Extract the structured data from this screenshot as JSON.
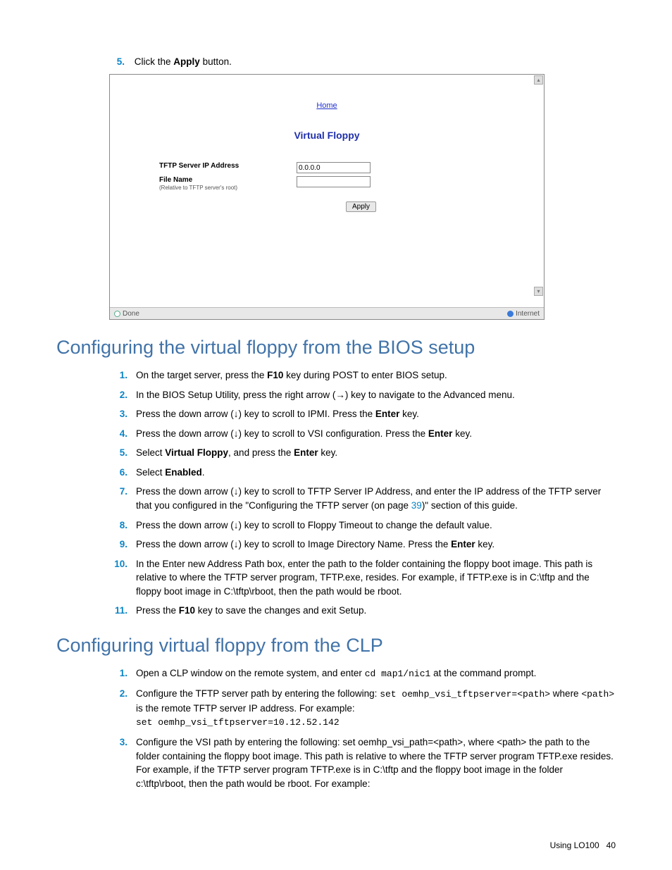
{
  "intro": {
    "num": "5.",
    "pre": "Click the ",
    "bold": "Apply",
    "post": " button."
  },
  "shot": {
    "home": "Home",
    "title": "Virtual Floppy",
    "row1_label": "TFTP Server IP Address",
    "row1_value": "0.0.0.0",
    "row2_label": "File Name",
    "row2_sub": "(Relative to TFTP server's root)",
    "apply": "Apply",
    "status_done": "Done",
    "status_net": "Internet"
  },
  "sec1": {
    "title": "Configuring the virtual floppy from the BIOS setup",
    "items": [
      {
        "n": "1.",
        "txt_pre": "On the target server, press the ",
        "b1": "F10",
        "txt_post": " key during POST to enter BIOS setup."
      },
      {
        "n": "2.",
        "txt": "In the BIOS Setup Utility, press the right arrow (→) key to navigate to the Advanced menu."
      },
      {
        "n": "3.",
        "txt_pre": "Press the down arrow (↓) key to scroll to IPMI. Press the ",
        "b1": "Enter",
        "txt_post": " key."
      },
      {
        "n": "4.",
        "txt_pre": "Press the down arrow (↓) key to scroll to VSI configuration. Press the ",
        "b1": "Enter",
        "txt_post": " key."
      },
      {
        "n": "5.",
        "txt_pre": "Select ",
        "b1": "Virtual Floppy",
        "txt_mid": ", and press the ",
        "b2": "Enter",
        "txt_post": " key."
      },
      {
        "n": "6.",
        "txt_pre": "Select ",
        "b1": "Enabled",
        "txt_post": "."
      },
      {
        "n": "7.",
        "txt_pre": "Press the down arrow (↓) key to scroll to TFTP Server IP Address, and enter the IP address of the TFTP server that you configured in the \"Configuring the TFTP server (on page ",
        "link": "39",
        "txt_post": ")\" section of this guide."
      },
      {
        "n": "8.",
        "txt": "Press the down arrow (↓) key to scroll to Floppy Timeout to change the default value."
      },
      {
        "n": "9.",
        "txt_pre": "Press the down arrow (↓) key to scroll to Image Directory Name. Press the ",
        "b1": "Enter",
        "txt_post": " key."
      },
      {
        "n": "10.",
        "txt": "In the Enter new Address Path box, enter the path to the folder containing the floppy boot image. This path is relative to where the TFTP server program, TFTP.exe, resides. For example, if TFTP.exe is in C:\\tftp and the floppy boot image in C:\\tftp\\rboot, then the path would be rboot."
      },
      {
        "n": "11.",
        "txt_pre": "Press the ",
        "b1": "F10",
        "txt_post": " key to save the changes and exit Setup."
      }
    ]
  },
  "sec2": {
    "title": "Configuring virtual floppy from the CLP",
    "items": [
      {
        "n": "1.",
        "parts": [
          {
            "t": "Open a CLP window on the remote system, and enter "
          },
          {
            "m": "cd map1/nic1"
          },
          {
            "t": " at the command prompt."
          }
        ]
      },
      {
        "n": "2.",
        "parts": [
          {
            "t": "Configure the TFTP server path by entering the following: "
          },
          {
            "m": "set oemhp_vsi_tftpserver=<path>"
          },
          {
            "t": " where "
          },
          {
            "m": "<path>"
          },
          {
            "t": " is the remote TFTP server IP address. For example:"
          },
          {
            "br": true
          },
          {
            "m": "set oemhp_vsi_tftpserver=10.12.52.142"
          }
        ]
      },
      {
        "n": "3.",
        "parts": [
          {
            "t": "Configure the VSI path by entering the following: set oemhp_vsi_path=<path>,  where <path> the path to the folder containing the floppy boot image. This path is relative to where the TFTP server program TFTP.exe resides. For example, if the TFTP server program TFTP.exe is in C:\\tftp and the floppy boot image in the folder c:\\tftp\\rboot, then the path would be rboot. For example:"
          }
        ]
      }
    ]
  },
  "footer": {
    "label": "Using LO100",
    "page": "40"
  }
}
